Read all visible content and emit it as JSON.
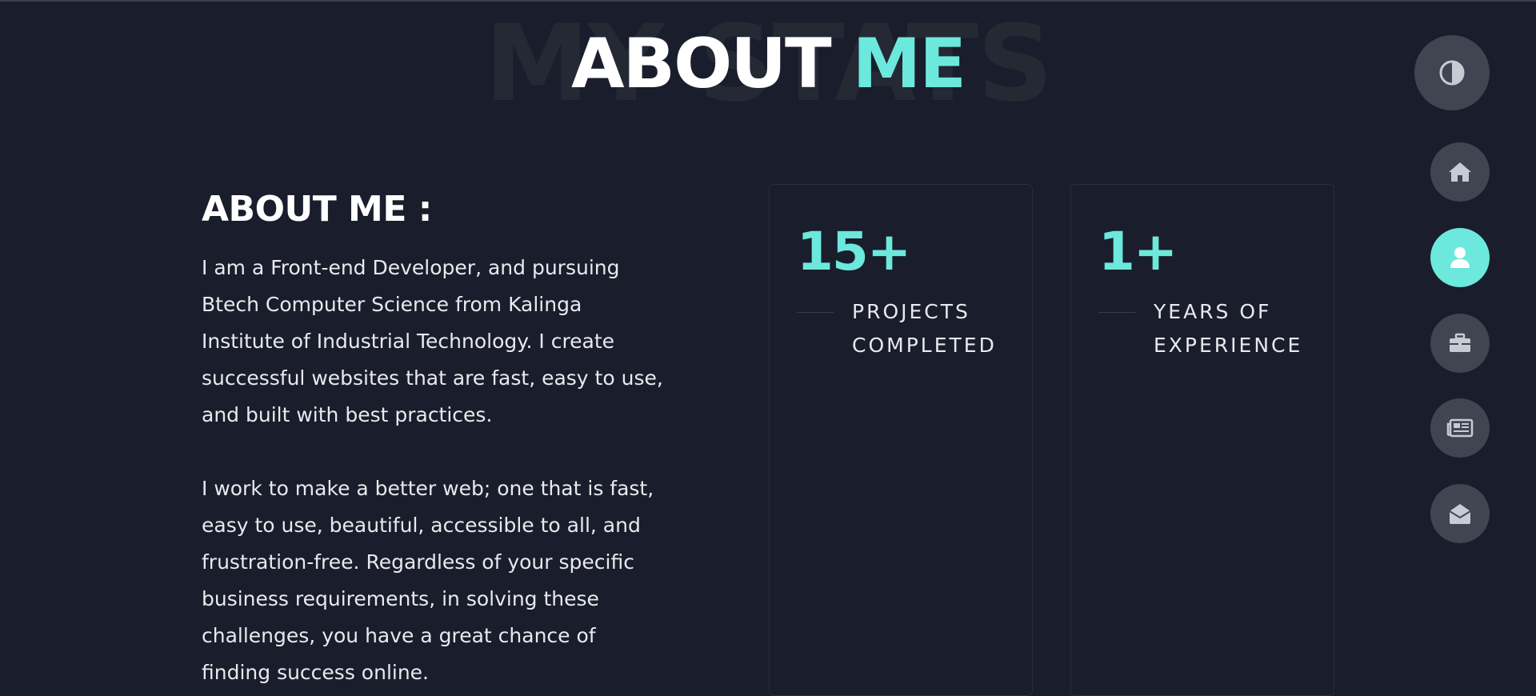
{
  "page": {
    "heading_background": "MY STATS",
    "heading_word1": "ABOUT",
    "heading_word2": "ME"
  },
  "about": {
    "title": "ABOUT ME :",
    "paragraph1": "I am a Front-end Developer, and pursuing Btech Computer Science from Kalinga Institute of Industrial Technology. I create successful websites that are fast, easy to use, and built with best practices.",
    "paragraph2": "I work to make a better web; one that is fast, easy to use, beautiful, accessible to all, and frustration-free. Regardless of your specific business requirements, in solving these challenges, you have a great chance of finding success online."
  },
  "stats": [
    {
      "value": "15+",
      "label": "PROJECTS COMPLETED"
    },
    {
      "value": "1+",
      "label": "YEARS OF EXPERIENCE"
    }
  ],
  "nav": {
    "theme_icon": "contrast-icon",
    "items": [
      {
        "icon": "home-icon",
        "active": false
      },
      {
        "icon": "user-icon",
        "active": true
      },
      {
        "icon": "briefcase-icon",
        "active": false
      },
      {
        "icon": "newspaper-icon",
        "active": false
      },
      {
        "icon": "envelope-open-icon",
        "active": false
      }
    ]
  },
  "colors": {
    "background": "#1a1d2b",
    "accent": "#6ce8dc",
    "nav_button": "#3f4551",
    "icon_gray": "#c7cbd4"
  }
}
